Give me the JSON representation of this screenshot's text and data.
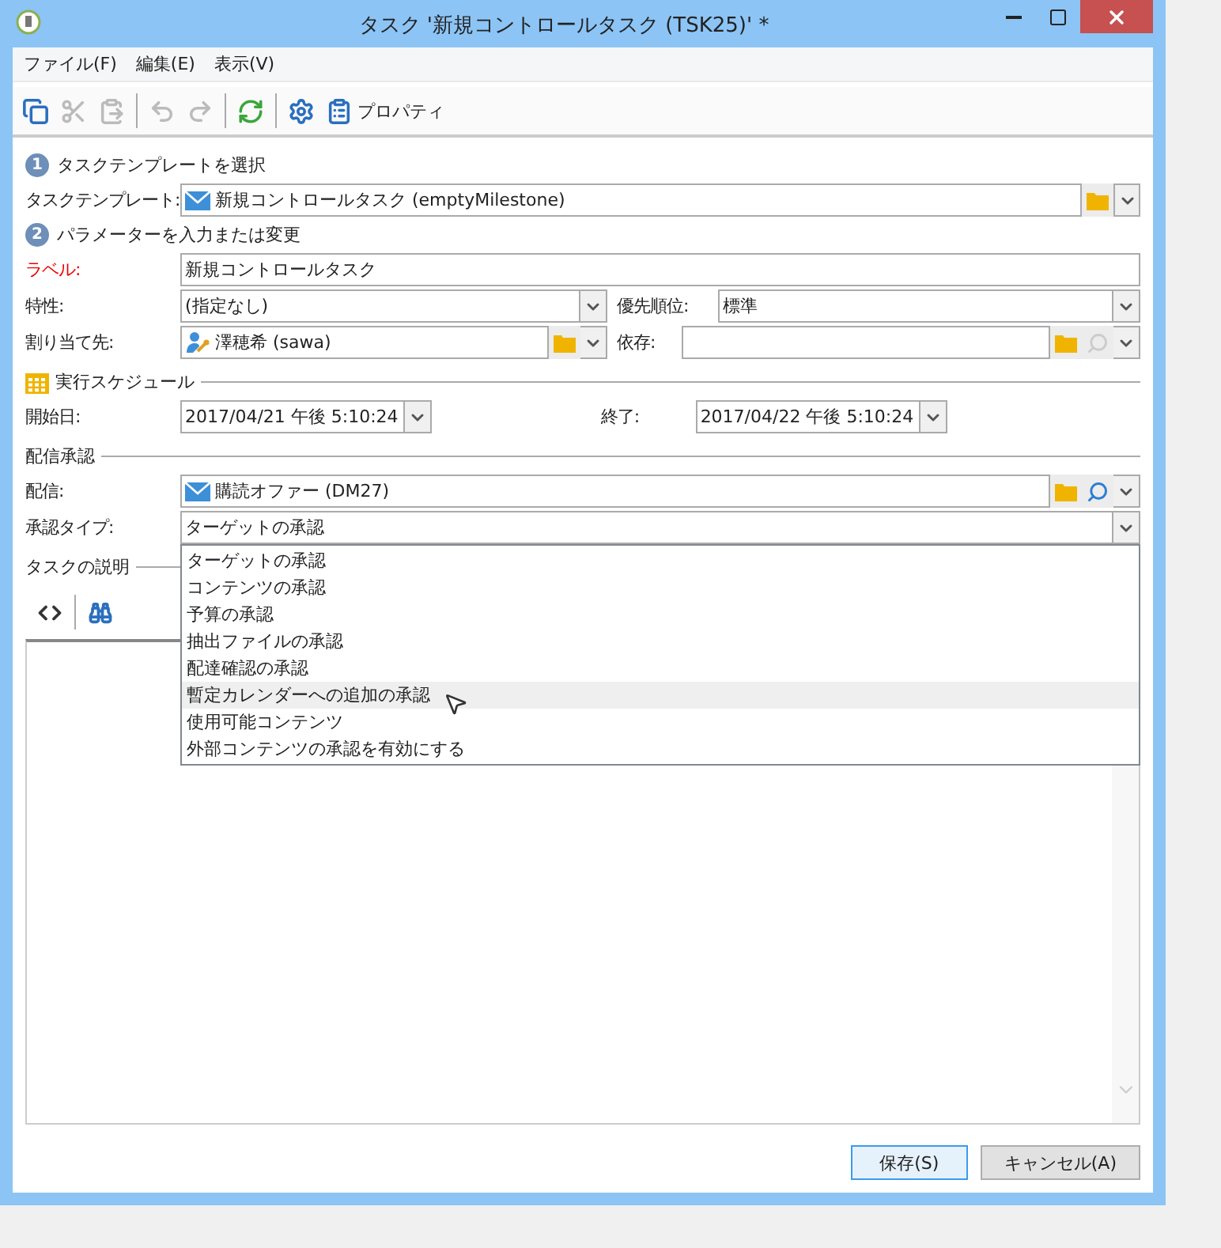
{
  "window": {
    "title": "タスク '新規コントロールタスク (TSK25)' *"
  },
  "menu": [
    {
      "label": "ファイル(F)"
    },
    {
      "label": "編集(E)"
    },
    {
      "label": "表示(V)"
    }
  ],
  "toolbar": [
    {
      "kind": "copy",
      "disabled": false
    },
    {
      "kind": "cut",
      "disabled": true
    },
    {
      "kind": "paste",
      "disabled": true
    },
    {
      "kind": "separator"
    },
    {
      "kind": "undo",
      "disabled": true
    },
    {
      "kind": "redo",
      "disabled": true
    },
    {
      "kind": "separator"
    },
    {
      "kind": "refresh",
      "disabled": false
    },
    {
      "kind": "separator"
    },
    {
      "kind": "settings",
      "disabled": false
    },
    {
      "kind": "properties",
      "disabled": false,
      "label": "プロパティ"
    }
  ],
  "template_section": {
    "number": "1",
    "title": "タスクテンプレートを選択",
    "label": "タスクテンプレート:",
    "value": "新規コントロールタスク (emptyMilestone)"
  },
  "parameters_section": {
    "number": "2",
    "title": "パラメーターを入力または変更",
    "label_field": {
      "label": "ラベル:",
      "value": "新規コントロールタスク",
      "required": true
    },
    "nature": {
      "label": "特性:",
      "value": "(指定なし)"
    },
    "priority": {
      "label": "優先順位:",
      "value": "標準"
    },
    "assignee": {
      "label": "割り当て先:",
      "value": "澤穂希 (sawa)"
    },
    "depends": {
      "label": "依存:",
      "lookup_disabled": true
    }
  },
  "schedule": {
    "title": "実行スケジュール",
    "start": {
      "label": "開始日:",
      "value": "2017/04/21 午後 5:10:24"
    },
    "end": {
      "label": "終了:",
      "value": "2017/04/22 午後 5:10:24"
    }
  },
  "approval": {
    "title": "配信承認",
    "delivery": {
      "label": "配信:",
      "value": "購読オファー (DM27)"
    },
    "approval_type": {
      "label": "承認タイプ:",
      "value": "ターゲットの承認",
      "expanded": true,
      "options": [
        {
          "label": "ターゲットの承認",
          "hovered": false
        },
        {
          "label": "コンテンツの承認",
          "hovered": false
        },
        {
          "label": "予算の承認",
          "hovered": false
        },
        {
          "label": "抽出ファイルの承認",
          "hovered": false
        },
        {
          "label": "配達確認の承認",
          "hovered": false
        },
        {
          "label": "暫定カレンダーへの追加の承認",
          "hovered": true
        },
        {
          "label": "使用可能コンテンツ",
          "hovered": false
        },
        {
          "label": "外部コンテンツの承認を有効にする",
          "hovered": false
        }
      ]
    }
  },
  "description": {
    "title": "タスクの説明"
  },
  "buttons": [
    {
      "label": "保存(S)",
      "focused": true
    },
    {
      "label": "キャンセル(A)",
      "focused": false
    }
  ]
}
